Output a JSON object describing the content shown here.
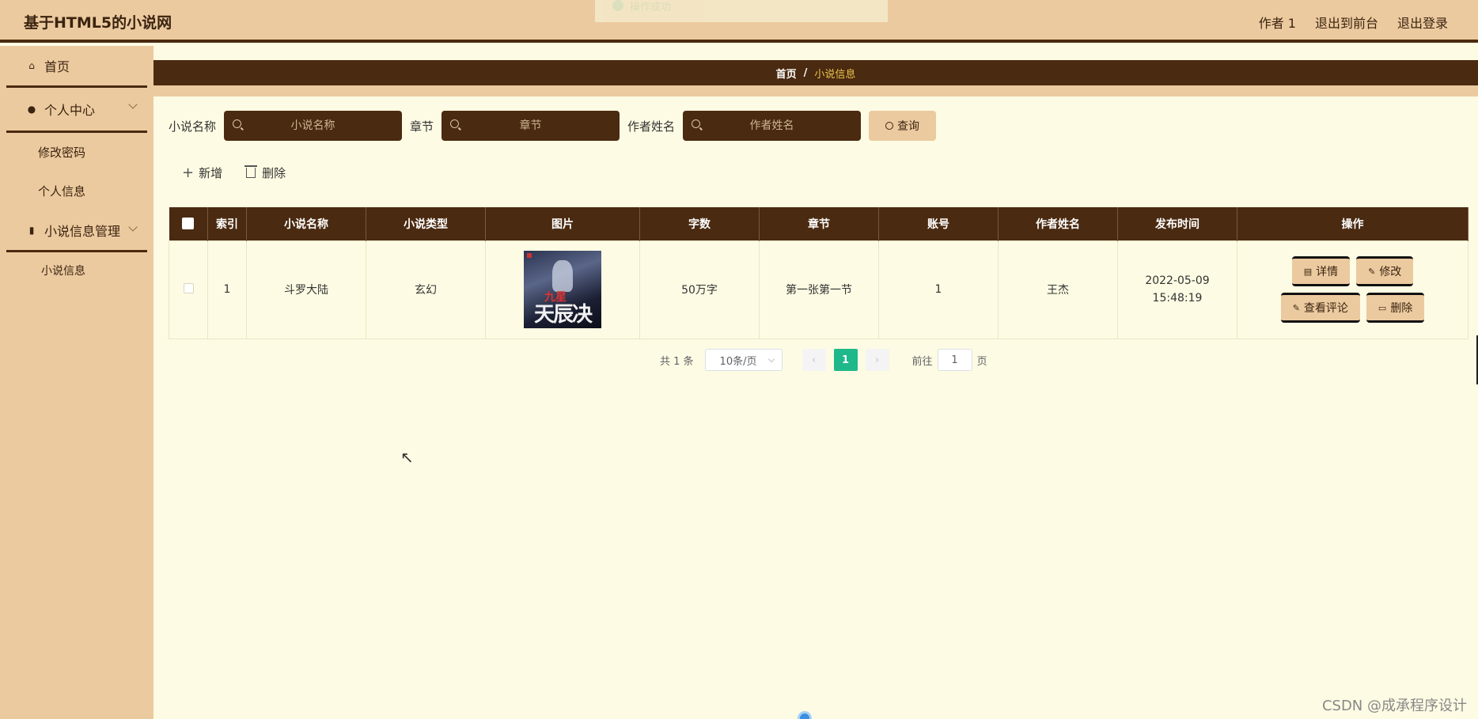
{
  "header": {
    "title": "基于HTML5的小说网",
    "user": "作者 1",
    "to_front": "退出到前台",
    "logout": "退出登录",
    "toast": "操作成功"
  },
  "sidebar": {
    "home": "首页",
    "personal_center": "个人中心",
    "change_password": "修改密码",
    "personal_info": "个人信息",
    "novel_management": "小说信息管理",
    "novel_info": "小说信息"
  },
  "breadcrumb": {
    "home": "首页",
    "separator": "/",
    "current": "小说信息"
  },
  "search": {
    "novel_name_label": "小说名称",
    "novel_name_placeholder": "小说名称",
    "chapter_label": "章节",
    "chapter_placeholder": "章节",
    "author_label": "作者姓名",
    "author_placeholder": "作者姓名",
    "query_button": "查询"
  },
  "actions": {
    "add": "新增",
    "delete": "删除"
  },
  "table": {
    "headers": [
      "索引",
      "小说名称",
      "小说类型",
      "图片",
      "字数",
      "章节",
      "账号",
      "作者姓名",
      "发布时间",
      "操作"
    ],
    "rows": [
      {
        "index": "1",
        "name": "斗罗大陆",
        "type": "玄幻",
        "cover_small_title": "九星",
        "cover_title": "天辰决",
        "words": "50万字",
        "chapter": "第一张第一节",
        "account": "1",
        "author": "王杰",
        "publish_time": "2022-05-09 15:48:19"
      }
    ],
    "ops": {
      "detail": "详情",
      "edit": "修改",
      "view_comments": "查看评论",
      "delete": "删除"
    }
  },
  "pagination": {
    "total": "共 1 条",
    "page_size": "10条/页",
    "current_page": "1",
    "goto_label": "前往",
    "goto_value": "1",
    "page_suffix": "页"
  },
  "watermark": "CSDN @成承程序设计",
  "colors": {
    "accent": "#ecca9f",
    "dark": "#4a2a10",
    "background": "#fdfbe3",
    "active_page": "#1fb88a"
  }
}
